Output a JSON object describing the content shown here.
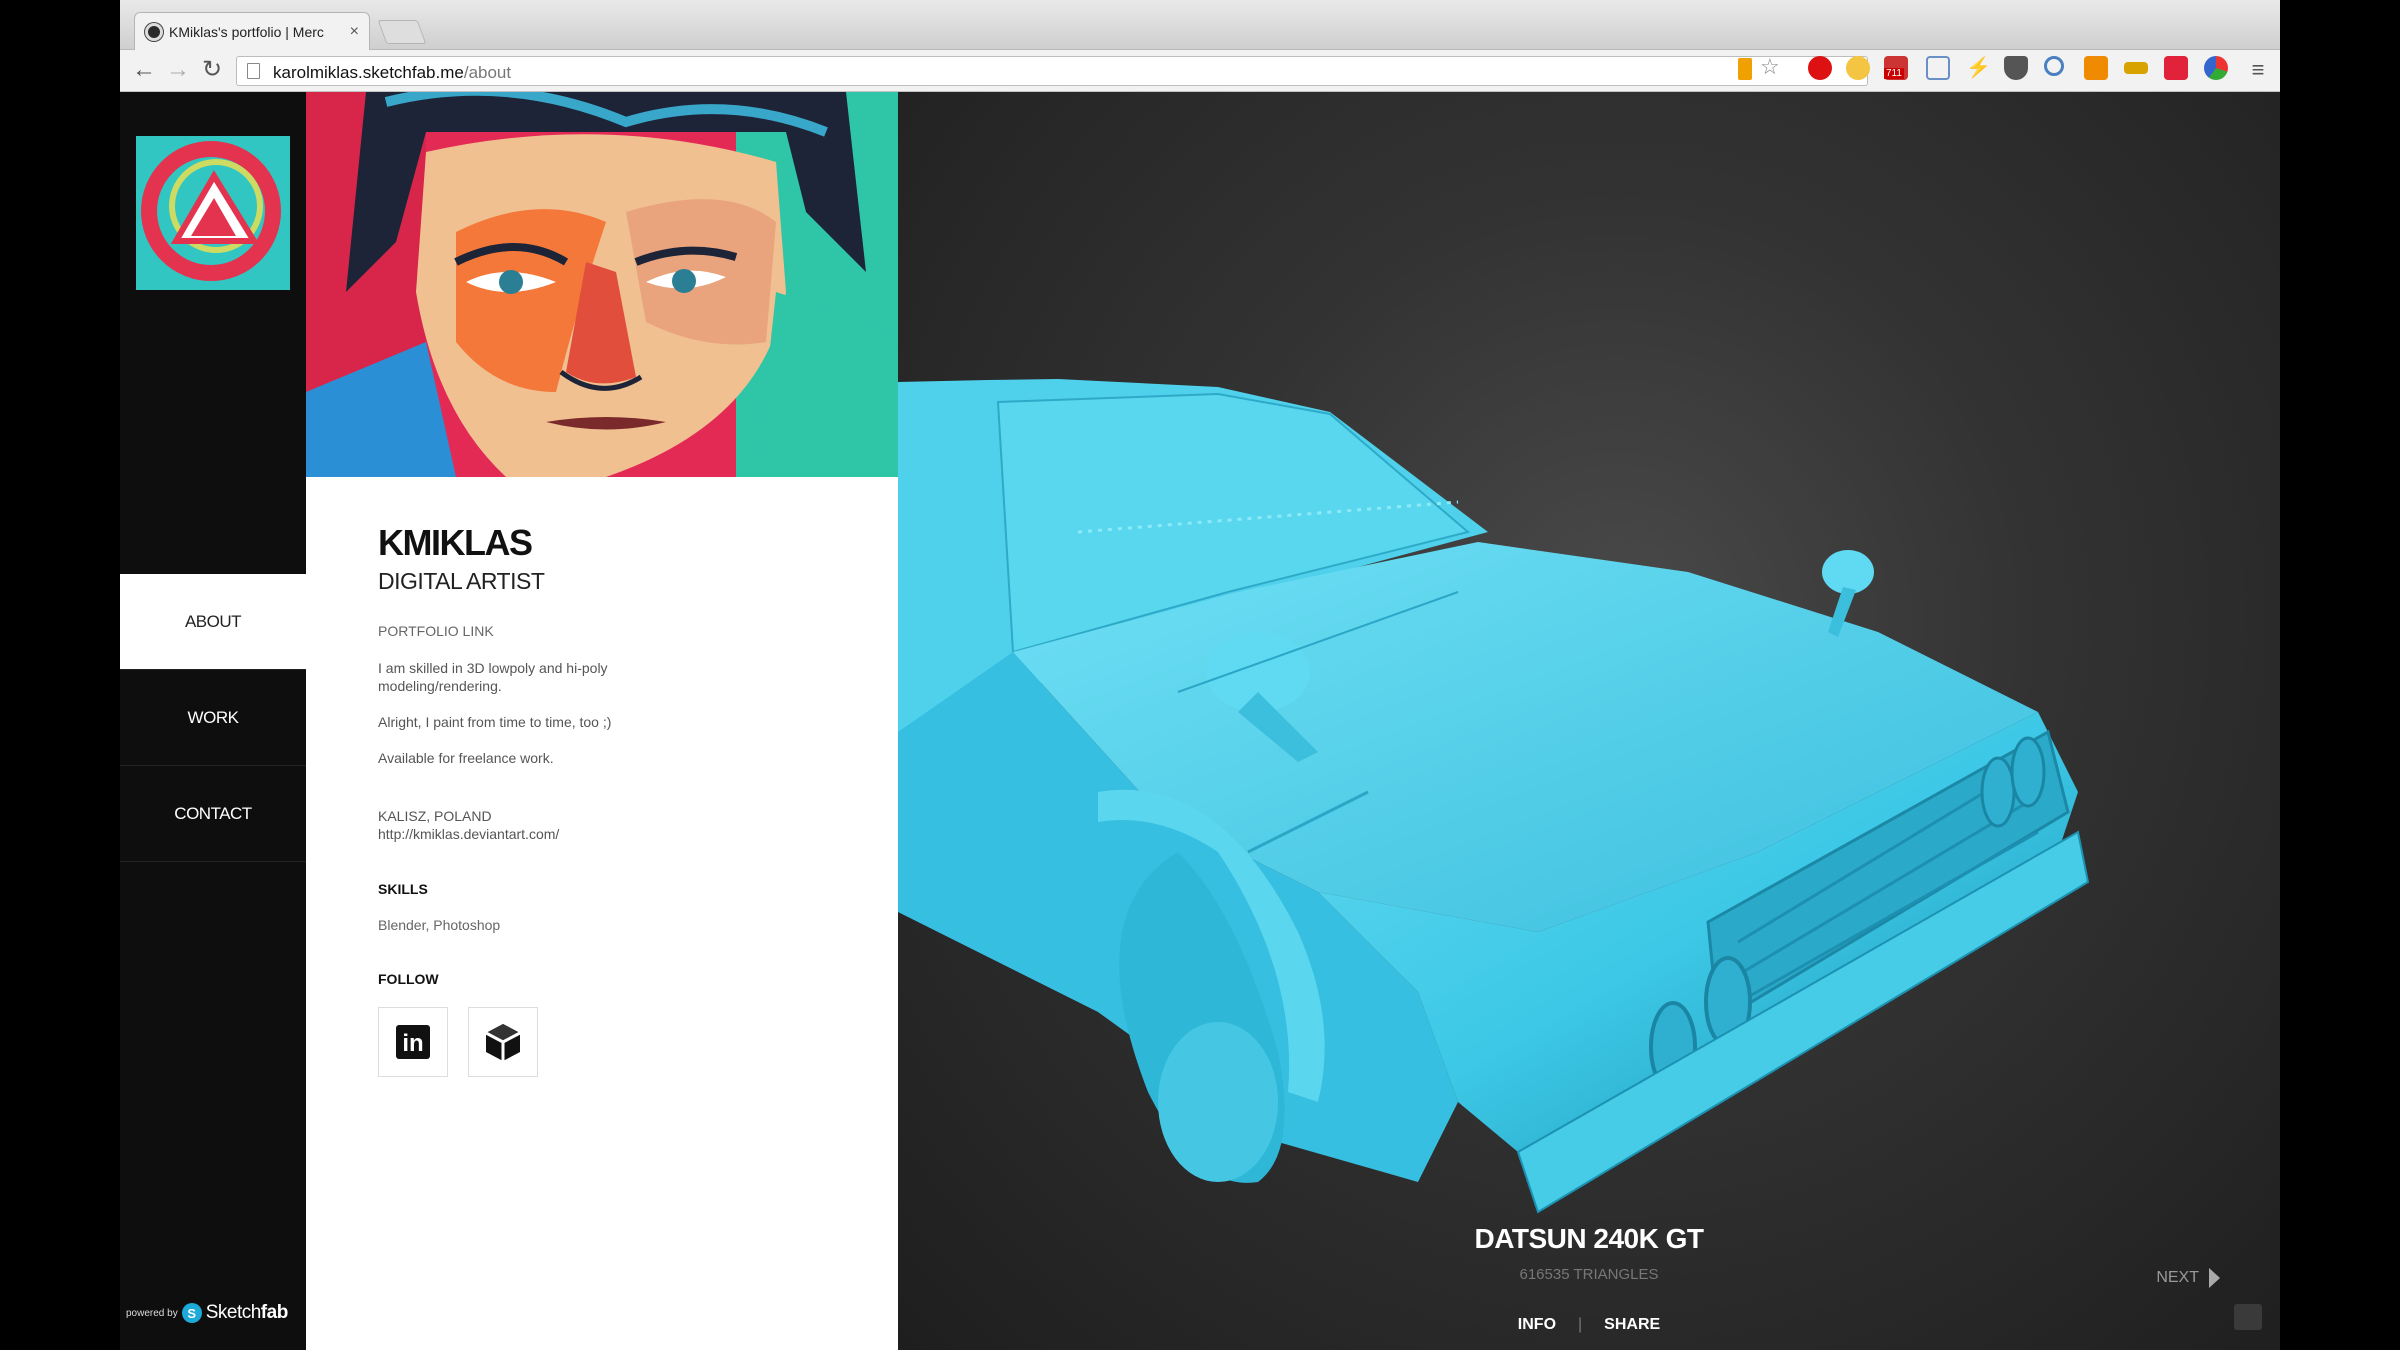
{
  "browser": {
    "tab_title": "KMiklas's portfolio | Merc",
    "tab_close": "×",
    "url_host": "karolmiklas.sketchfab.me",
    "url_path": "/about",
    "nav_back": "←",
    "nav_forward": "→",
    "nav_reload": "↻",
    "menu": "≡",
    "extension_badge": "711"
  },
  "sidebar": {
    "nav": [
      {
        "label": "ABOUT",
        "active": true
      },
      {
        "label": "WORK",
        "active": false
      },
      {
        "label": "CONTACT",
        "active": false
      }
    ],
    "powered_small": "powered by",
    "powered_brand_a": "Sketch",
    "powered_brand_b": "fab"
  },
  "profile": {
    "name": "KMIKLAS",
    "role": "DIGITAL ARTIST",
    "portfolio_link": "PORTFOLIO LINK",
    "bio": [
      "I am skilled in 3D lowpoly and hi-poly modeling/rendering.",
      "Alright, I paint from time to time, too ;)",
      "Available for freelance work."
    ],
    "location": "KALISZ, POLAND",
    "website": "http://kmiklas.deviantart.com/",
    "skills_heading": "SKILLS",
    "skills": "Blender, Photoshop",
    "follow_heading": "FOLLOW",
    "linkedin_glyph": "in"
  },
  "model": {
    "title": "DATSUN 240K GT",
    "subtitle": "616535 TRIANGLES",
    "info_label": "INFO",
    "separator": "|",
    "share_label": "SHARE",
    "next_label": "NEXT"
  },
  "colors": {
    "model_color": "#3cc8e6",
    "sketchfab_blue": "#1caad9"
  }
}
